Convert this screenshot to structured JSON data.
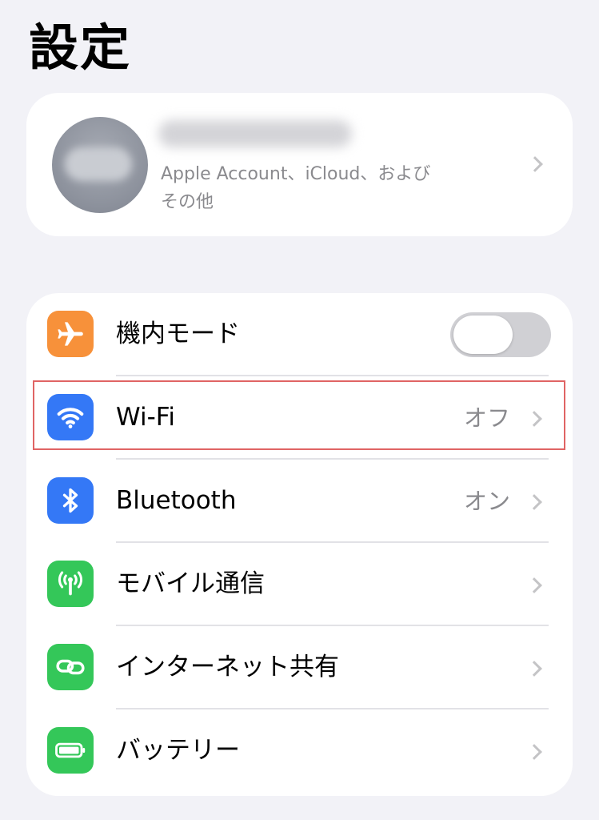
{
  "page": {
    "title": "設定"
  },
  "account": {
    "subtitle_line1": "Apple Account、iCloud、および",
    "subtitle_line2": "その他"
  },
  "settings": [
    {
      "id": "airplane",
      "label": "機内モード",
      "icon": "airplane-icon",
      "icon_color": "#f7913a",
      "control": "toggle",
      "toggle_on": false
    },
    {
      "id": "wifi",
      "label": "Wi-Fi",
      "value": "オフ",
      "icon": "wifi-icon",
      "icon_color": "#3478f6",
      "control": "chevron"
    },
    {
      "id": "bluetooth",
      "label": "Bluetooth",
      "value": "オン",
      "icon": "bluetooth-icon",
      "icon_color": "#3478f6",
      "control": "chevron"
    },
    {
      "id": "cellular",
      "label": "モバイル通信",
      "icon": "antenna-icon",
      "icon_color": "#34c759",
      "control": "chevron"
    },
    {
      "id": "hotspot",
      "label": "インターネット共有",
      "icon": "link-icon",
      "icon_color": "#34c759",
      "control": "chevron"
    },
    {
      "id": "battery",
      "label": "バッテリー",
      "icon": "battery-icon",
      "icon_color": "#34c759",
      "control": "chevron"
    }
  ],
  "highlight": {
    "target": "wifi",
    "color": "#e06464"
  }
}
